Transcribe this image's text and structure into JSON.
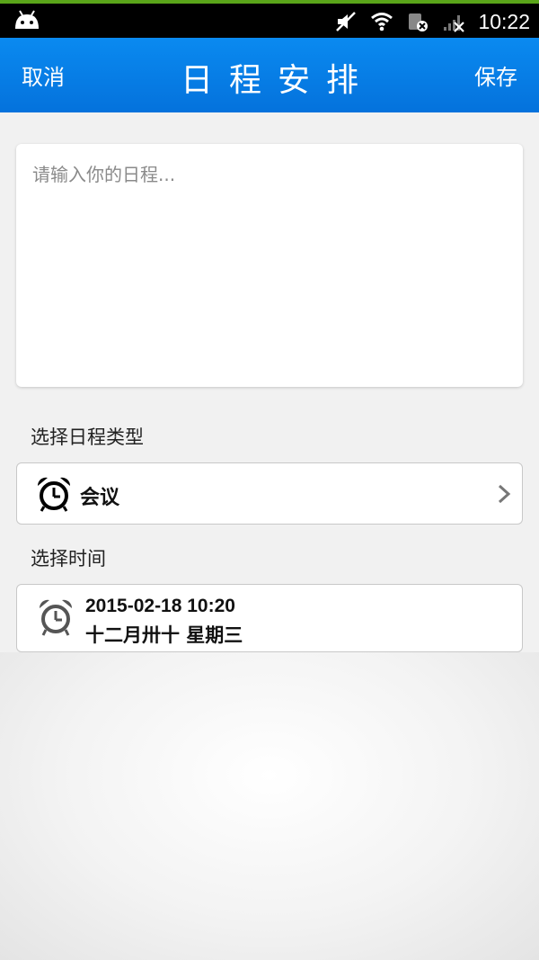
{
  "status_bar": {
    "time": "10:22",
    "icons": [
      "android-icon",
      "mute-icon",
      "wifi-icon",
      "data-sim-icon",
      "signal-icon"
    ]
  },
  "header": {
    "cancel_label": "取消",
    "title": "日程安排",
    "save_label": "保存"
  },
  "editor": {
    "value": "",
    "placeholder": "请输入你的日程..."
  },
  "schedule_type": {
    "section_label": "选择日程类型",
    "selected": "会议",
    "icon": "alarm-clock-icon"
  },
  "schedule_time": {
    "section_label": "选择时间",
    "datetime": "2015-02-18 10:20",
    "lunar_date": "十二月卅十 星期三",
    "icon": "alarm-clock-icon"
  },
  "colors": {
    "header_blue": "#0a8af0",
    "status_green": "#5aa51a"
  }
}
